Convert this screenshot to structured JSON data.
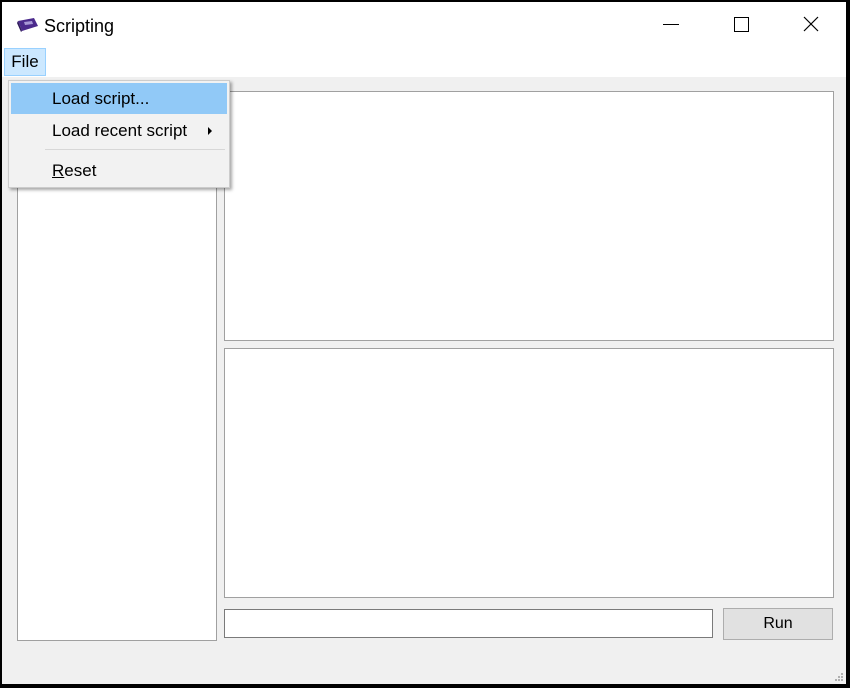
{
  "window": {
    "title": "Scripting"
  },
  "menubar": {
    "file_label": "File"
  },
  "file_menu": {
    "items": [
      {
        "label": "Load script...",
        "highlighted": true
      },
      {
        "label": "Load recent script",
        "has_submenu": true
      },
      {
        "label": "Reset",
        "mnemonic": "R"
      }
    ]
  },
  "command": {
    "value": "",
    "placeholder": ""
  },
  "run_button": {
    "label": "Run"
  },
  "colors": {
    "menu_highlight": "#91c9f7",
    "menubar_active": "#cce8ff",
    "window_bg": "#f0f0f0"
  },
  "icons": {
    "app": "app-logo-icon",
    "minimize": "minimize-icon",
    "maximize": "maximize-icon",
    "close": "close-icon",
    "submenu": "chevron-right-icon",
    "resize": "resize-grip-icon"
  }
}
